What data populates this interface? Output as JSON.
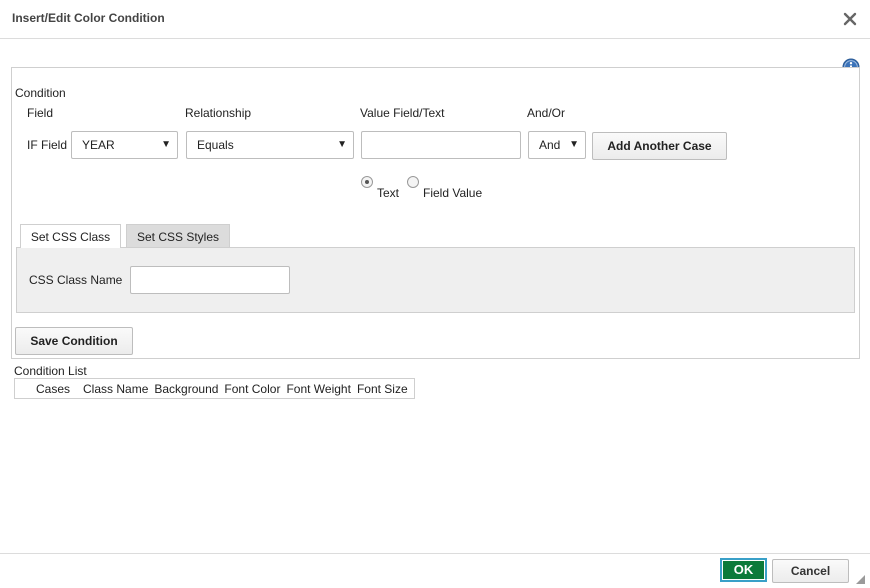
{
  "dialog": {
    "title": "Insert/Edit Color Condition"
  },
  "condition": {
    "section_label": "Condition",
    "headers": {
      "field": "Field",
      "relationship": "Relationship",
      "value": "Value Field/Text",
      "andor": "And/Or"
    },
    "if_field_label": "IF Field",
    "field_select": "YEAR",
    "relationship_select": "Equals",
    "value_input": "",
    "andor_select": "And",
    "add_case_button": "Add Another Case",
    "radio_text": "Text",
    "radio_field_value": "Field Value",
    "radio_selected": "Text"
  },
  "tabs": [
    {
      "label": "Set CSS Class",
      "active": true
    },
    {
      "label": "Set CSS Styles",
      "active": false
    }
  ],
  "css_class": {
    "label": "CSS Class Name",
    "value": ""
  },
  "save_button": "Save Condition",
  "condition_list": {
    "label": "Condition List",
    "columns": [
      "Cases",
      "Class Name",
      "Background",
      "Font Color",
      "Font Weight",
      "Font Size"
    ]
  },
  "footer": {
    "ok": "OK",
    "cancel": "Cancel"
  },
  "colors": {
    "ok_bg": "#0b7a3a",
    "ok_focus": "#39a0c8",
    "info_icon": "#3b73b9"
  },
  "icons": [
    "close-icon",
    "info-icon",
    "dropdown-arrow-icon",
    "resize-grip-icon"
  ]
}
